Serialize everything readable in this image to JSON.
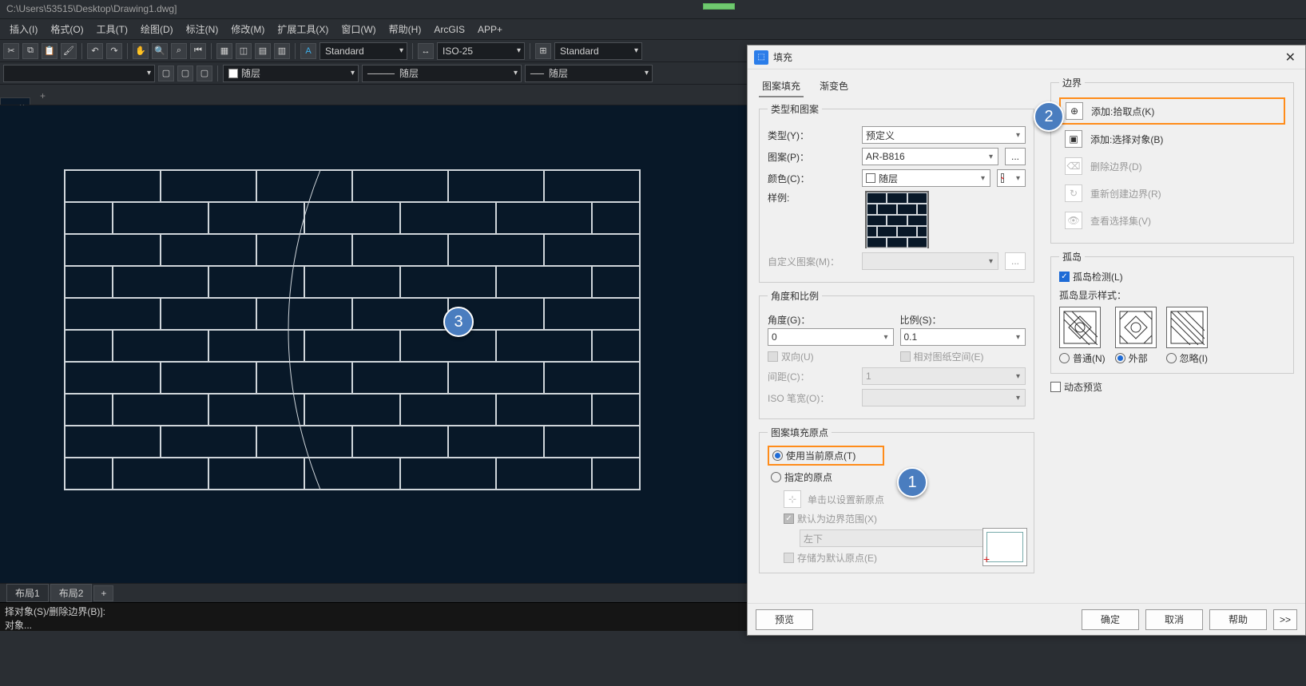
{
  "titlebar": {
    "path": "C:\\Users\\53515\\Desktop\\Drawing1.dwg]"
  },
  "menubar": [
    "插入(I)",
    "格式(O)",
    "工具(T)",
    "绘图(D)",
    "标注(N)",
    "修改(M)",
    "扩展工具(X)",
    "窗口(W)",
    "帮助(H)",
    "ArcGIS",
    "APP+"
  ],
  "toolbar1": {
    "style1": "Standard",
    "style2": "ISO-25",
    "style3": "Standard"
  },
  "toolbar2": {
    "layer_color": "随层",
    "linetype": "随层",
    "lineweight": "随层"
  },
  "filetab": {
    "empty": ""
  },
  "layouts": {
    "tab1": "布局1",
    "tab2": "布局2",
    "add": "+"
  },
  "cmd": {
    "line1": "择对象(S)/删除边界(B)]:",
    "line2": "对象..."
  },
  "dialog": {
    "title": "填充",
    "tab_pattern": "图案填充",
    "tab_gradient": "渐变色",
    "g1_legend": "类型和图案",
    "l_type": "类型(Y)：",
    "v_type": "预定义",
    "l_pattern": "图案(P)：",
    "v_pattern": "AR-B816",
    "btn_more": "...",
    "l_color": "颜色(C)：",
    "v_color": "随层",
    "l_sample": "样例:",
    "l_custom": "自定义图案(M)：",
    "g2_legend": "角度和比例",
    "l_angle": "角度(G)：",
    "v_angle": "0",
    "l_scale": "比例(S)：",
    "v_scale": "0.1",
    "cb_double": "双向(U)",
    "cb_relpaper": "相对图纸空间(E)",
    "l_spacing": "间距(C)：",
    "v_spacing": "1",
    "l_penwidth": "ISO 笔宽(O)：",
    "g3_legend": "图案填充原点",
    "r_currorigin": "使用当前原点(T)",
    "r_specorigin": "指定的原点",
    "l_clicknew": "单击以设置新原点",
    "cb_defaultext": "默认为边界范围(X)",
    "v_extpos": "左下",
    "cb_store": "存储为默认原点(E)",
    "g_boundary": "边界",
    "b_pickpoint": "添加:拾取点(K)",
    "b_selobj": "添加:选择对象(B)",
    "b_delbound": "删除边界(D)",
    "b_recreate": "重新创建边界(R)",
    "b_viewsel": "查看选择集(V)",
    "g_island": "孤岛",
    "cb_island": "孤岛检测(L)",
    "l_islandstyle": "孤岛显示样式：",
    "r_normal": "普通(N)",
    "r_outer": "外部",
    "r_ignore": "忽略(I)",
    "cb_dynprev": "动态预览",
    "btn_preview": "预览",
    "btn_ok": "确定",
    "btn_cancel": "取消",
    "btn_help": "帮助",
    "btn_expand": ">>"
  },
  "callouts": {
    "c1": "1",
    "c2": "2",
    "c3": "3"
  }
}
